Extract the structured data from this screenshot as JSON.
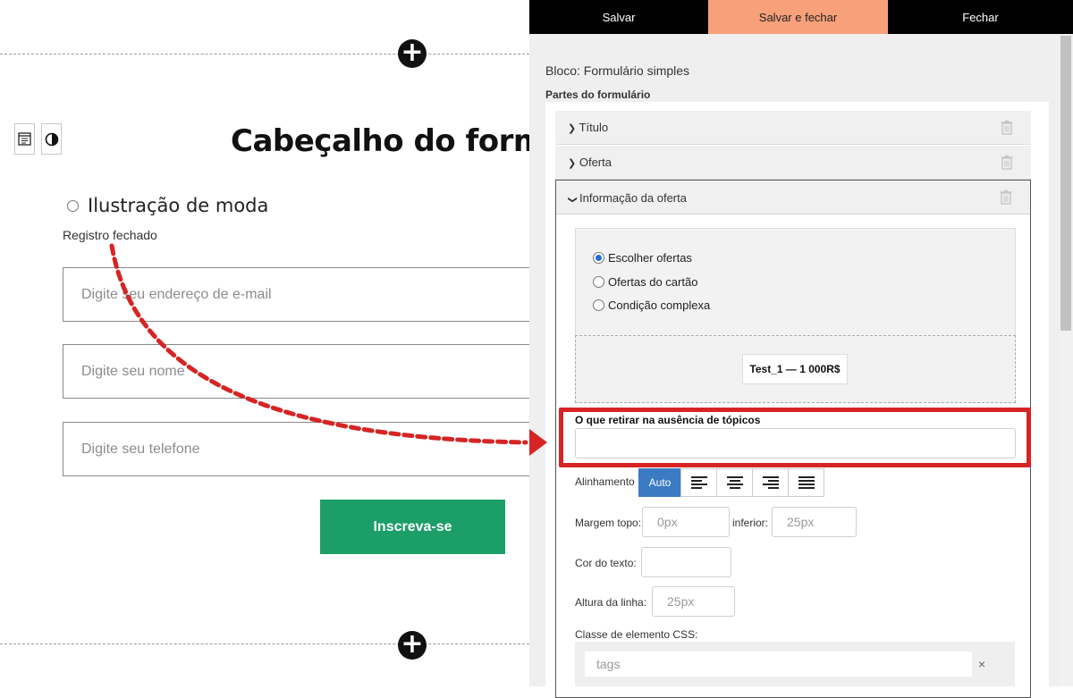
{
  "preview": {
    "heading": "Cabeçalho do formu",
    "radio_label": "Ilustração de moda",
    "closed_note": "Registro fechado",
    "email_placeholder": "Digite seu endereço de e-mail",
    "name_placeholder": "Digite seu nome",
    "phone_placeholder": "Digite seu telefone",
    "subscribe_label": "Inscreva-se"
  },
  "topbar": {
    "save": "Salvar",
    "save_close": "Salvar e fechar",
    "close": "Fechar"
  },
  "panel": {
    "block_title": "Bloco: Formulário simples",
    "parts_title": "Partes do formulário",
    "parts": [
      {
        "label": "Título"
      },
      {
        "label": "Oferta"
      },
      {
        "label": "Informação da oferta"
      }
    ],
    "offer_modes": [
      "Escolher ofertas",
      "Ofertas do cartão",
      "Condição complexa"
    ],
    "selected_mode": "Escolher ofertas",
    "offer_chip": "Test_1 — 1 000R$",
    "missing_topics_label": "O que retirar na ausência de tópicos",
    "missing_topics_value": "",
    "alignment_label": "Alinhamento",
    "alignment_auto": "Auto",
    "margin_top_label": "Margem topo:",
    "margin_top_placeholder": "0px",
    "margin_bottom_label": "inferior:",
    "margin_bottom_placeholder": "25px",
    "text_color_label": "Cor do texto:",
    "line_height_label": "Altura da linha:",
    "line_height_placeholder": "25px",
    "css_class_label": "Classe de elemento CSS:",
    "tags_placeholder": "tags",
    "tags_clear": "×"
  },
  "colors": {
    "accent_button": "#f8a07a",
    "subscribe_green": "#1c9e69",
    "highlight_red": "#d62424",
    "auto_blue": "#3b7bc4"
  }
}
